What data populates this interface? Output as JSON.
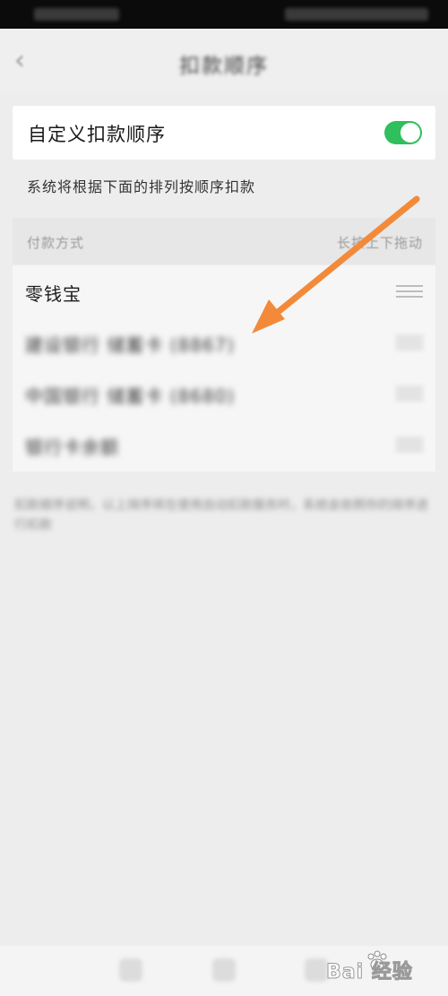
{
  "nav": {
    "back_icon": "chevron-left-icon",
    "title": "扣款顺序"
  },
  "toggle_section": {
    "label": "自定义扣款顺序",
    "enabled": true,
    "accent_color": "#2fbf5c"
  },
  "hint_text": "系统将根据下面的排列按顺序扣款",
  "list_header": {
    "left": "付款方式",
    "right": "长按上下拖动"
  },
  "payment_methods": [
    {
      "label": "零钱宝",
      "blurred": false
    },
    {
      "label": "建设银行 储蓄卡 (8867)",
      "blurred": true
    },
    {
      "label": "中国银行 储蓄卡 (8680)",
      "blurred": true
    },
    {
      "label": "银行卡余额",
      "blurred": true
    }
  ],
  "note_text": "扣款顺序说明，以上排序将在使用自动扣款服务时，系统会依照你的排序进行扣款",
  "annotation": {
    "arrow_color": "#f28a3a"
  },
  "watermark": {
    "text": "Bai 经验"
  }
}
